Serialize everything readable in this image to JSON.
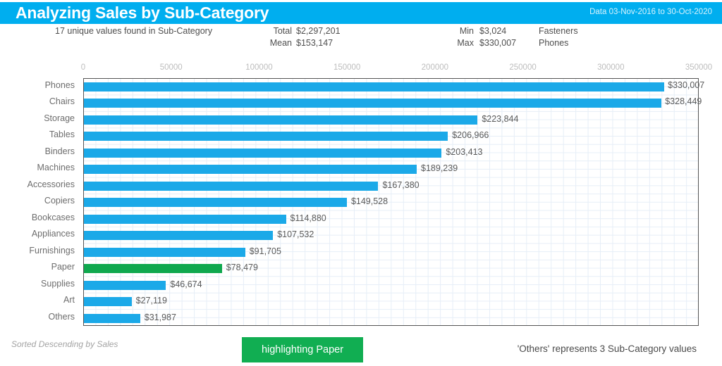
{
  "header": {
    "title": "Analyzing Sales by Sub-Category",
    "date_range": "Data  03-Nov-2016 to 30-Oct-2020",
    "bar_color": "#00AEEF"
  },
  "stats": {
    "unique_values_text": "17 unique values found in Sub-Category",
    "total_label": "Total",
    "total_value": "$2,297,201",
    "mean_label": "Mean",
    "mean_value": "$153,147",
    "min_label": "Min",
    "min_value": "$3,024",
    "min_category": "Fasteners",
    "max_label": "Max",
    "max_value": "$330,007",
    "max_category": "Phones"
  },
  "footer": {
    "sorted_text": "Sorted Descending by Sales",
    "highlight_button_label": "highlighting Paper",
    "others_note": "'Others' represents 3 Sub-Category values"
  },
  "colors": {
    "bar": "#1BA9E8",
    "highlight": "#0FA84E",
    "button": "#11AE52",
    "grid": "#e6eef7",
    "axis": "#555555"
  },
  "chart_data": {
    "type": "bar",
    "orientation": "horizontal",
    "title": "Analyzing Sales by Sub-Category",
    "xlabel": "",
    "ylabel": "",
    "xlim": [
      0,
      350000
    ],
    "grid": true,
    "legend": false,
    "highlighted_category": "Paper",
    "tick_labels": [
      "0",
      "50000",
      "100000",
      "150000",
      "200000",
      "250000",
      "300000",
      "350000"
    ],
    "ticks": [
      0,
      50000,
      100000,
      150000,
      200000,
      250000,
      300000,
      350000
    ],
    "categories": [
      "Phones",
      "Chairs",
      "Storage",
      "Tables",
      "Binders",
      "Machines",
      "Accessories",
      "Copiers",
      "Bookcases",
      "Appliances",
      "Furnishings",
      "Paper",
      "Supplies",
      "Art",
      "Others"
    ],
    "values": [
      330007,
      328449,
      223844,
      206966,
      203413,
      189239,
      167380,
      149528,
      114880,
      107532,
      91705,
      78479,
      46674,
      27119,
      31987
    ],
    "value_labels": [
      "$330,007",
      "$328,449",
      "$223,844",
      "$206,966",
      "$203,413",
      "$189,239",
      "$167,380",
      "$149,528",
      "$114,880",
      "$107,532",
      "$91,705",
      "$78,479",
      "$46,674",
      "$27,119",
      "$31,987"
    ]
  }
}
